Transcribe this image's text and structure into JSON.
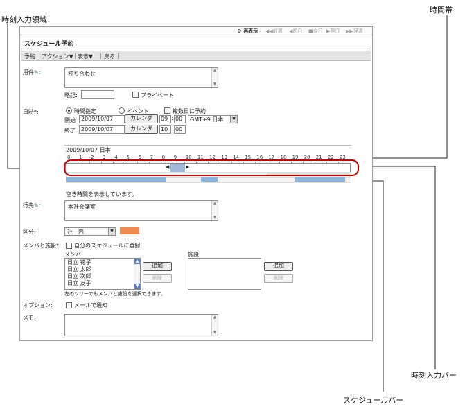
{
  "callouts": {
    "time_input_area": "時刻入力領域",
    "time_zone": "時間帯",
    "time_input_bar": "時刻入力バー",
    "schedule_bar": "スケジュールバー"
  },
  "nav": {
    "reload": "再表示",
    "prev_week": "前週",
    "prev_day": "前日",
    "today": "今日",
    "next_day": "翌日",
    "next_week": "翌週"
  },
  "page_title": "スケジュール予約",
  "menu": {
    "reserve": "予約",
    "action": "アクション▼",
    "view": "表示▼",
    "back": "戻る"
  },
  "form": {
    "subject_label": "用件",
    "subject_value": "打ち合わせ",
    "abbr_label": "略記:",
    "private_label": "プライベート",
    "datetime_label": "日時*:",
    "time_spec_label": "時間指定",
    "event_label": "イベント",
    "multi_day_label": "複数日に予約",
    "start_label": "開始",
    "end_label": "終了",
    "start_date": "2009/10/07",
    "end_date": "2009/10/07",
    "calendar_btn": "カレンダ",
    "start_hour": "09",
    "start_min": "00",
    "end_hour": "10",
    "end_min": "00",
    "timezone": "GMT+9 日本",
    "timeline_header": "2009/10/07 日本",
    "hours": [
      "0",
      "1",
      "2",
      "3",
      "4",
      "5",
      "6",
      "7",
      "8",
      "9",
      "10",
      "11",
      "12",
      "13",
      "14",
      "15",
      "16",
      "17",
      "18",
      "19",
      "20",
      "21",
      "22",
      "23"
    ],
    "free_time_note": "空き時間を表示しています。",
    "dest_label": "行先",
    "dest_value": "本社会議室",
    "category_label": "区分:",
    "category_value": "社　内",
    "members_label": "メンバと施設*:",
    "register_self_label": "自分のスケジュールに登録",
    "members_header": "メンバ",
    "facilities_header": "施設",
    "members": [
      "日立 花子",
      "日立 太郎",
      "日立 次郎",
      "日立 友子"
    ],
    "add_btn": "追加",
    "delete_btn": "削除",
    "tree_note": "左のツリーでもメンバと施設を選択できます。",
    "option_label": "オプション:",
    "mail_notify_label": "メールで通知",
    "memo_label": "メモ:"
  },
  "colors": {
    "highlight": "#cc0000",
    "busy": "#8ab4e0",
    "category": "#f08a50",
    "selection": "#9fb8d8"
  }
}
